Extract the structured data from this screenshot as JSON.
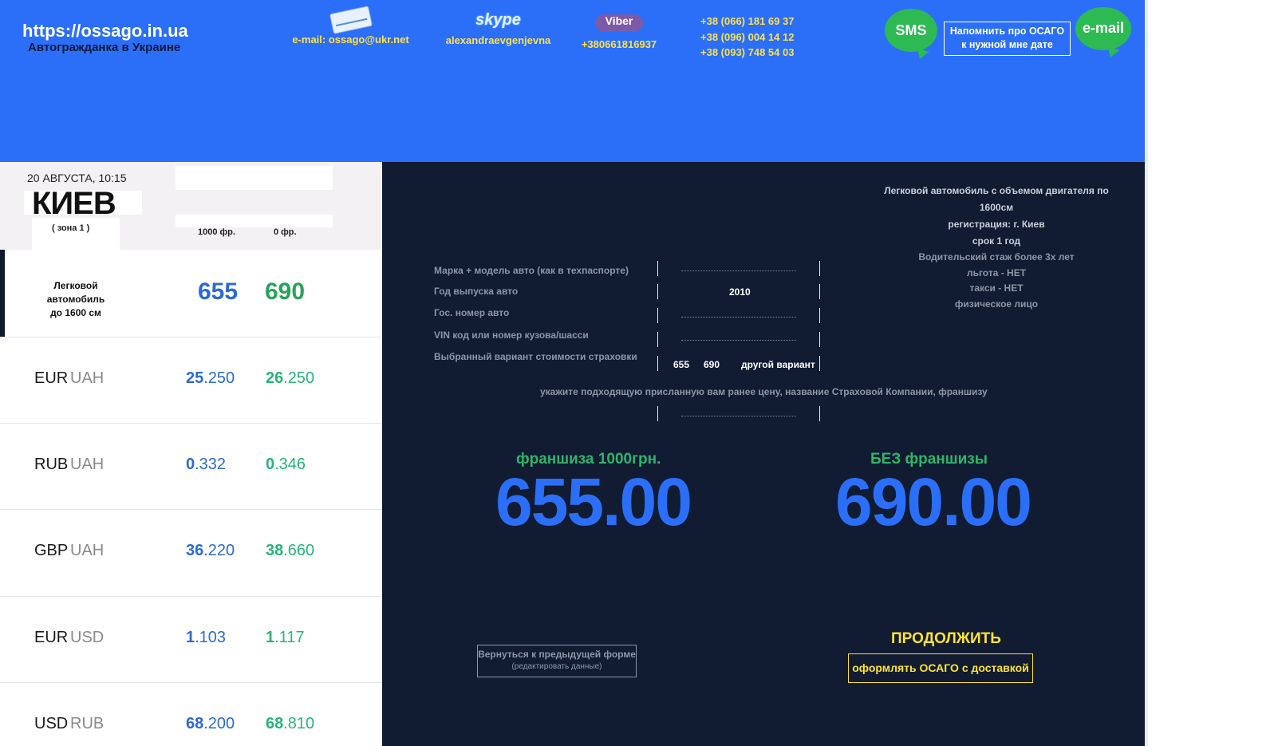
{
  "header": {
    "site_url": "https://ossago.in.ua",
    "site_subtitle": "Автогражданка в Украине",
    "email": "e-mail: ossago@ukr.net",
    "skype_logo": "skype",
    "skype_name": "alexandraevgenjevna",
    "viber_logo": "Viber",
    "viber_number": "+380661816937",
    "phones": [
      "+38 (066) 181 69 37",
      "+38 (096) 004 14 12",
      "+38 (093) 748 54 03"
    ],
    "sms_label": "SMS",
    "remind_line1": "Напомнить про ОСАГО",
    "remind_line2": "к нужной мне дате",
    "email_bubble": "e-mail"
  },
  "left": {
    "date": "20 АВГУСТА, 10:15",
    "city": "КИЕВ",
    "zone": "( зона 1 )",
    "col1": "1000 фр.",
    "col2": "0 фр.",
    "car_line1": "Легковой автомобиль",
    "car_line2": "до 1600 см",
    "price_1000": "655",
    "price_0": "690",
    "rates": [
      {
        "base": "EUR",
        "quote": "UAH",
        "buy_int": "25",
        "buy_dec": ".250",
        "sell_int": "26",
        "sell_dec": ".250"
      },
      {
        "base": "RUB",
        "quote": "UAH",
        "buy_int": "0",
        "buy_dec": ".332",
        "sell_int": "0",
        "sell_dec": ".346"
      },
      {
        "base": "GBP",
        "quote": "UAH",
        "buy_int": "36",
        "buy_dec": ".220",
        "sell_int": "38",
        "sell_dec": ".660"
      },
      {
        "base": "EUR",
        "quote": "USD",
        "buy_int": "1",
        "buy_dec": ".103",
        "sell_int": "1",
        "sell_dec": ".117"
      },
      {
        "base": "USD",
        "quote": "RUB",
        "buy_int": "68",
        "buy_dec": ".200",
        "sell_int": "68",
        "sell_dec": ".810"
      }
    ]
  },
  "summary": {
    "line1": "Легковой автомобиль с объемом двигателя по 1600см",
    "line2": "регистрация: г. Киев",
    "line3": "срок 1 год",
    "line4": "Водительский стаж более 3х лет",
    "line5": "льгота - НЕТ",
    "line6": "такси - НЕТ",
    "line7": "физическое лицо"
  },
  "form": {
    "label_model": "Марка + модель авто (как в техпаспорте)",
    "label_year": "Год выпуска авто",
    "year_value": "2010",
    "label_plate": "Гос. номер авто",
    "label_vin": "VIN код или номер кузова/шасси",
    "label_variant": "Выбранный вариант стоимости страховки",
    "opt_655": "655",
    "opt_690": "690",
    "opt_other": "другой вариант",
    "hint": "укажите подходящую присланную вам ранее цену,  название Страховой Компании, франшизу"
  },
  "result": {
    "franchise_label": "франшиза 1000грн.",
    "franchise_price": "655.00",
    "no_franchise_label": "БЕЗ франшизы",
    "no_franchise_price": "690.00"
  },
  "actions": {
    "back_line1": "Вернуться к предыдущей форме",
    "back_line2": "(редактировать данные)",
    "continue": "ПРОДОЛЖИТЬ",
    "order": "оформлять ОСАГО с доставкой"
  }
}
